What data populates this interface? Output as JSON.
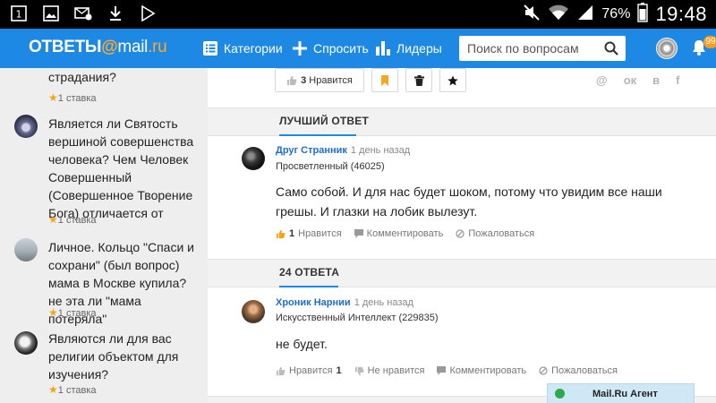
{
  "status_bar": {
    "battery": "76%",
    "time": "19:48",
    "icons": [
      "notification-1-icon",
      "image-icon",
      "email-icon",
      "download-icon",
      "play-store-icon",
      "mute-icon",
      "wifi-icon",
      "signal-icon",
      "battery-icon"
    ],
    "notif_number": "1"
  },
  "header": {
    "logo_main": "ОТВЕТЫ",
    "logo_at": "@",
    "logo_domain": "mail",
    "logo_tld": ".ru",
    "nav": [
      {
        "label": "Категории",
        "icon": "categories-icon"
      },
      {
        "label": "Спросить",
        "icon": "plus-icon"
      },
      {
        "label": "Лидеры",
        "icon": "bar-chart-icon"
      }
    ],
    "search_placeholder": "Поиск по вопросам",
    "notifications_count": "99"
  },
  "sidebar": {
    "questions": [
      {
        "title": "страдания?",
        "bets": "1 ставка"
      },
      {
        "title": "Является ли Святость вершиной совершенства человека? Чем Человек Совершенный (Совершенное Творение Бога) отличается от",
        "bets": "1 ставка"
      },
      {
        "title": "Личное. Кольцо \"Спаси и сохрани\" (был вопрос) мама в Москве купила? не эта ли \"мама потеряла\"",
        "bets": "1 ставка"
      },
      {
        "title": "Являются ли для вас религии объектом для изучения?",
        "bets": "1 ставка"
      }
    ]
  },
  "question_actions": {
    "like_count": "3",
    "like_label": "Нравится",
    "socials": [
      "@",
      "ок",
      "в",
      "f"
    ]
  },
  "best_answer": {
    "section_title": "ЛУЧШИЙ ОТВЕТ",
    "author": "Друг Странник",
    "time": "1 день назад",
    "rank": "Просветленный (46025)",
    "text": "Само собой. И для нас будет шоком, потому что увидим все наши грешы. И глазки на лобик вылезут.",
    "likes": "1",
    "like_label": "Нравится",
    "comment_label": "Комментировать",
    "report_label": "Пожаловаться"
  },
  "answers": {
    "section_title": "24 ОТВЕТА",
    "items": [
      {
        "author": "Хроник Нарнии",
        "time": "1 день назад",
        "rank": "Искусственный Интеллект (229835)",
        "text": "не будет.",
        "like_label": "Нравится",
        "likes": "1",
        "dislike_label": "Не нравится",
        "comment_label": "Комментировать",
        "report_label": "Пожаловаться"
      }
    ]
  },
  "agent": {
    "title": "Mail.Ru Агент"
  },
  "colors": {
    "header_bg": "#1e88e5",
    "accent_orange": "#ffa930",
    "link_blue": "#1e6fc8",
    "star": "#f2a51a"
  }
}
